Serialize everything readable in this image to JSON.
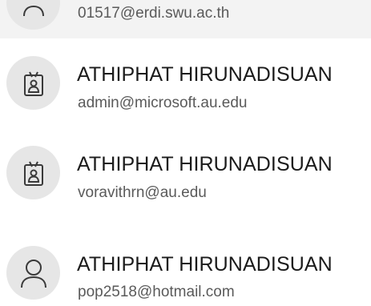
{
  "accounts": [
    {
      "email": "01517@erdi.swu.ac.th",
      "icon": "person-icon",
      "selected": true
    },
    {
      "name": "ATHIPHAT HIRUNADISUAN",
      "email": "admin@microsoft.au.edu",
      "icon": "badge-id-icon"
    },
    {
      "name": "ATHIPHAT HIRUNADISUAN",
      "email": "voravithrn@au.edu",
      "icon": "badge-id-icon"
    },
    {
      "name": "ATHIPHAT HIRUNADISUAN",
      "email": "pop2518@hotmail.com",
      "icon": "person-icon"
    }
  ],
  "colors": {
    "selected_row_bg": "#f3f3f3",
    "avatar_bg": "#e6e6e6",
    "name_text": "#1b1b1b",
    "email_text": "#5a5a5a",
    "icon_stroke": "#3a3a3a"
  }
}
